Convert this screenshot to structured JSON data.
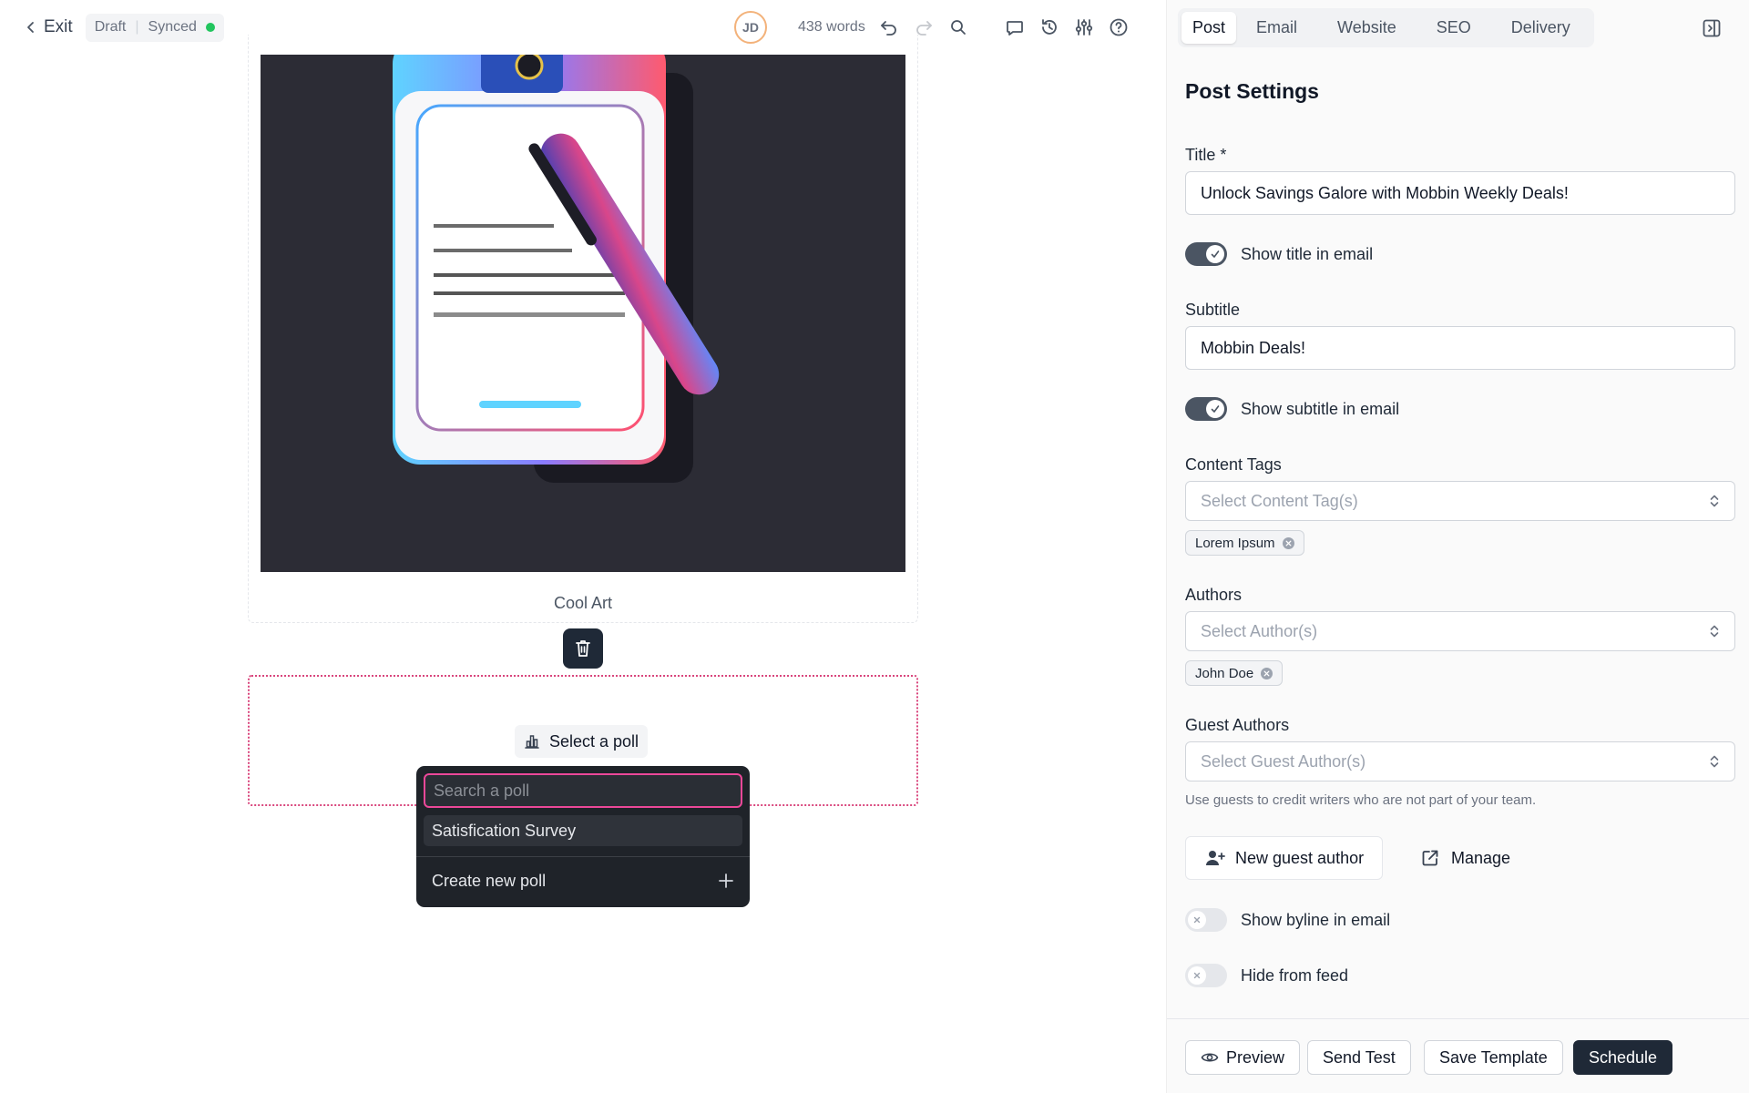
{
  "topbar": {
    "exit_label": "Exit",
    "status": "Draft",
    "sync": "Synced",
    "avatar_initials": "JD",
    "word_count": "438 words"
  },
  "image_block": {
    "caption": "Cool Art"
  },
  "poll": {
    "select_label": "Select a poll",
    "search_placeholder": "Search a poll",
    "options": [
      "Satisfication Survey"
    ],
    "create_label": "Create new poll"
  },
  "panel": {
    "tabs": [
      "Post",
      "Email",
      "Website",
      "SEO",
      "Delivery"
    ],
    "active_tab": "Post",
    "heading": "Post Settings",
    "title_label": "Title *",
    "title_value": "Unlock Savings Galore with Mobbin Weekly Deals!",
    "show_title_label": "Show title in email",
    "subtitle_label": "Subtitle",
    "subtitle_value": "Mobbin Deals!",
    "show_subtitle_label": "Show subtitle in email",
    "tags_label": "Content Tags",
    "tags_placeholder": "Select Content Tag(s)",
    "tag_chip": "Lorem Ipsum",
    "authors_label": "Authors",
    "authors_placeholder": "Select Author(s)",
    "author_chip": "John Doe",
    "guest_label": "Guest Authors",
    "guest_placeholder": "Select Guest Author(s)",
    "guest_helper": "Use guests to credit writers who are not part of your team.",
    "new_guest_label": "New guest author",
    "manage_label": "Manage",
    "byline_label": "Show byline in email",
    "hide_feed_label": "Hide from feed"
  },
  "footer": {
    "preview": "Preview",
    "send_test": "Send Test",
    "save_template": "Save Template",
    "schedule": "Schedule"
  },
  "colors": {
    "accent_pink": "#ec4899",
    "dark": "#1f2937",
    "synced_dot": "#22c55e",
    "toggle_on": "#4b5563"
  }
}
